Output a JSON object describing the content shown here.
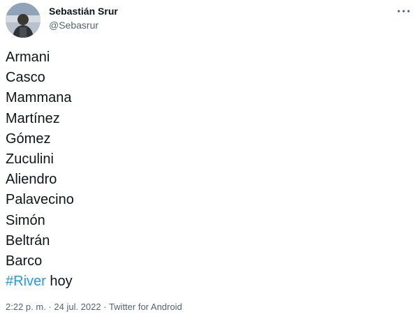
{
  "author": {
    "display_name": "Sebastián Srur",
    "handle": "@Sebasrur"
  },
  "icons": {
    "avatar": "profile-photo",
    "more": "more-horizontal-icon"
  },
  "tweet": {
    "lines": [
      "Armani",
      "Casco",
      "Mammana",
      "Martínez",
      "Gómez",
      "Zuculini",
      "Aliendro",
      "Palavecino",
      "Simón",
      "Beltrán",
      "Barco"
    ],
    "last_line": {
      "hashtag": "#River",
      "text": " hoy"
    }
  },
  "meta": {
    "time": "2:22 p. m.",
    "separator": " · ",
    "date": "24 jul. 2022",
    "separator2": " · ",
    "source": "Twitter for Android"
  },
  "colors": {
    "hashtag": "#1d9bf0",
    "secondary_text": "#536471",
    "primary_text": "#0f1419"
  }
}
